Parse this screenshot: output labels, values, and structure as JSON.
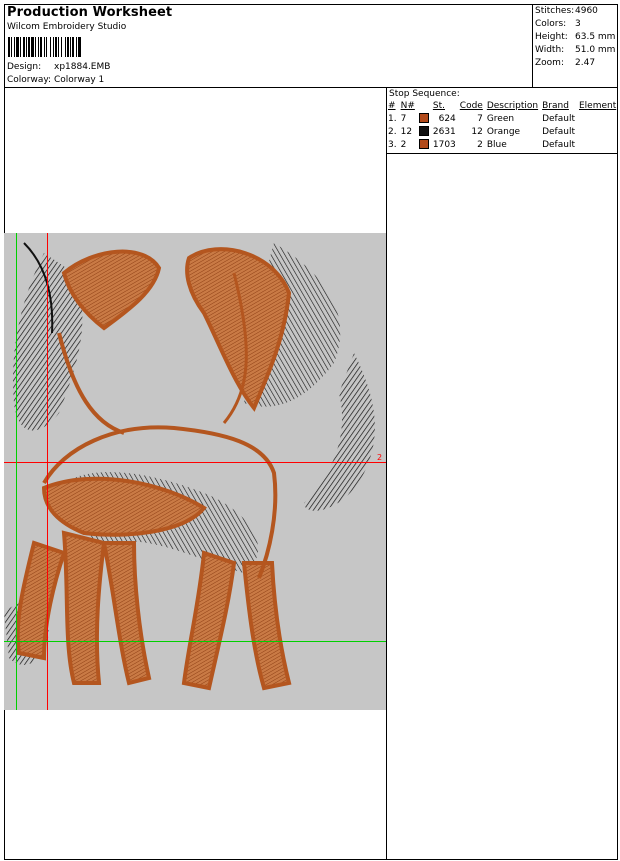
{
  "header": {
    "title": "Production Worksheet",
    "subtitle": "Wilcom  Embroidery Studio",
    "design_label": "Design:",
    "design_value": "xp1884.EMB",
    "colorway_label": "Colorway:",
    "colorway_value": "Colorway  1"
  },
  "stats": [
    {
      "label": "Stitches:",
      "value": "4960"
    },
    {
      "label": "Colors:",
      "value": "3"
    },
    {
      "label": "Height:",
      "value": "63.5 mm"
    },
    {
      "label": "Width:",
      "value": "51.0 mm"
    },
    {
      "label": "Zoom:",
      "value": "2.47"
    }
  ],
  "stop_sequence": {
    "title": "Stop Sequence:",
    "columns": [
      "#",
      "N#",
      "St.",
      "Code",
      "Description",
      "Brand",
      "Element"
    ],
    "rows": [
      {
        "num": "1.",
        "n": "7",
        "color": "#b24a1a",
        "st": "624",
        "code": "7",
        "description": "Green",
        "brand": "Default",
        "element": ""
      },
      {
        "num": "2.",
        "n": "12",
        "color": "#111111",
        "st": "2631",
        "code": "12",
        "description": "Orange",
        "brand": "Default",
        "element": ""
      },
      {
        "num": "3.",
        "n": "2",
        "color": "#b24a1a",
        "st": "1703",
        "code": "2",
        "description": "Blue",
        "brand": "Default",
        "element": ""
      }
    ]
  },
  "design": {
    "stop_marker": "2",
    "colors": {
      "background": "#c6c6c6",
      "thread_orange": "#b4561f",
      "thread_black": "#111111",
      "guide_red": "#ff0000",
      "guide_green": "#00d000"
    }
  }
}
